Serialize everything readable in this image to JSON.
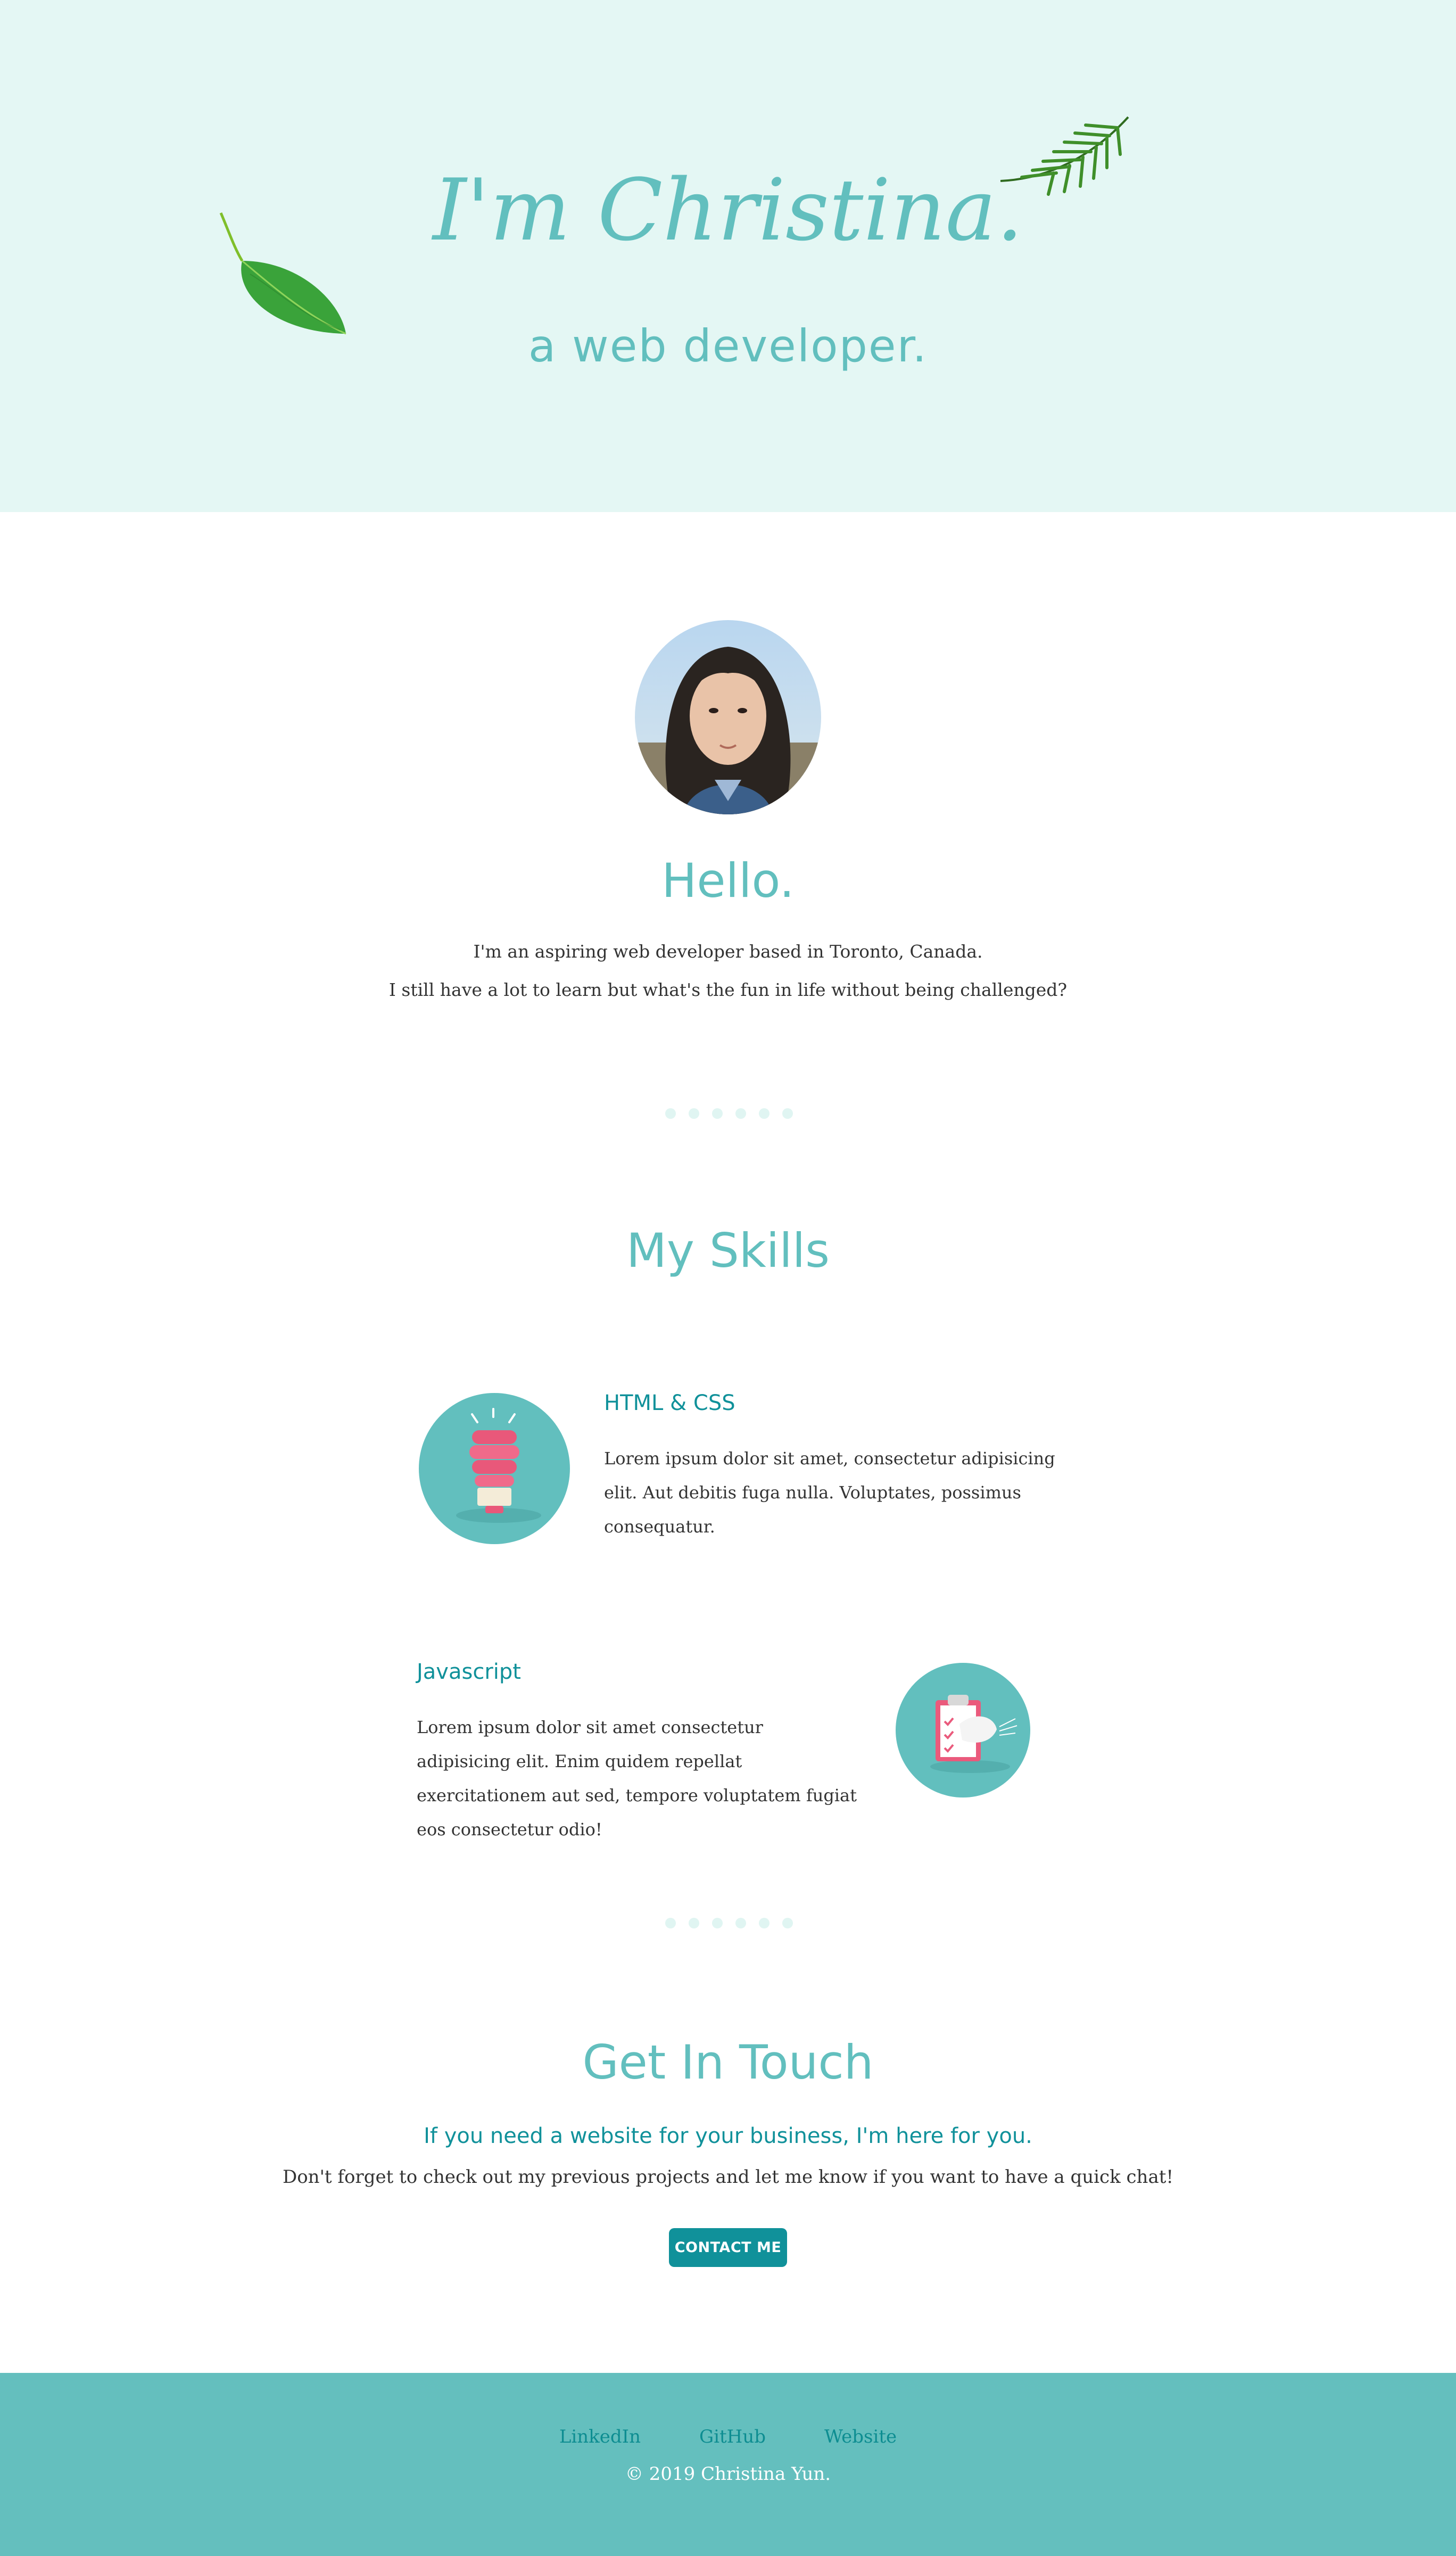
{
  "hero": {
    "title": "I'm Christina.",
    "subtitle": "a web developer."
  },
  "about": {
    "heading": "Hello.",
    "line1": "I'm an aspiring web developer based in Toronto, Canada.",
    "line2": "I still have a lot to learn but what's the fun in life without being challenged?"
  },
  "skills": {
    "heading": "My Skills",
    "items": [
      {
        "name": "HTML & CSS",
        "description": "Lorem ipsum dolor sit amet, consectetur adipisicing elit. Aut debitis fuga nulla. Voluptates, possimus consequatur.",
        "icon": "lightbulb-icon"
      },
      {
        "name": "Javascript",
        "description": "Lorem ipsum dolor sit amet consectetur adipisicing elit. Enim quidem repellat exercitationem aut sed, tempore voluptatem fugiat eos consectetur odio!",
        "icon": "clipboard-icon"
      }
    ]
  },
  "contact": {
    "heading": "Get In Touch",
    "tagline": "If you need a website for your business, I'm here for you.",
    "note": "Don't forget to check out my previous projects and let me know if you want to have a quick chat!",
    "button_label": "CONTACT ME"
  },
  "footer": {
    "links": [
      "LinkedIn",
      "GitHub",
      "Website"
    ],
    "copyright": "© 2019 Christina Yun."
  },
  "colors": {
    "hero_bg": "#e4f7f4",
    "accent": "#62bfbe",
    "dark_teal": "#10919a",
    "footer_bg": "#64bfbe",
    "dot": "#e0f5f2"
  }
}
